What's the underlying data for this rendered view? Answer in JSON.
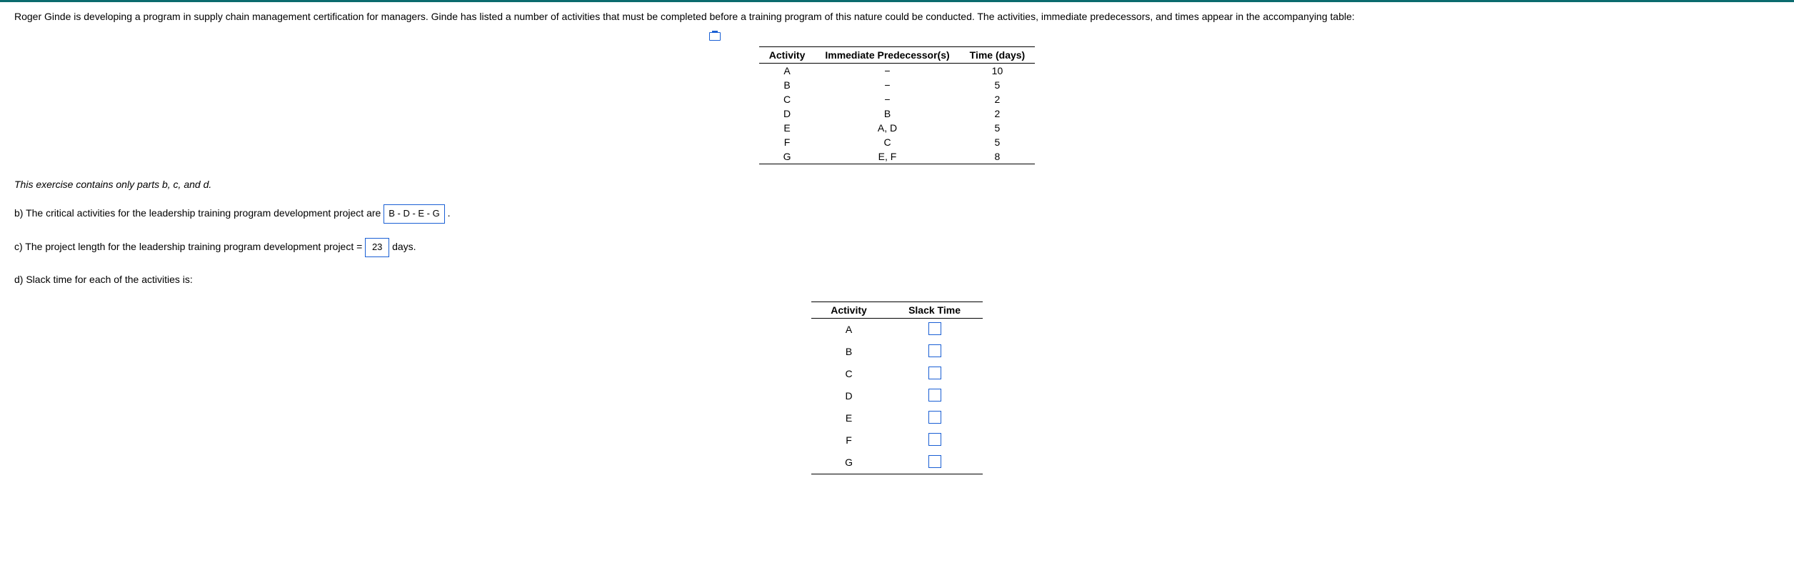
{
  "intro": "Roger Ginde is developing a program in supply chain management certification for managers. Ginde has listed a number of activities that must be completed before a training program of this nature could be conducted. The activities, immediate predecessors, and times appear in the accompanying table:",
  "table1": {
    "headers": {
      "c1": "Activity",
      "c2": "Immediate Predecessor(s)",
      "c3": "Time (days)"
    },
    "rows": [
      {
        "activity": "A",
        "pred": "−",
        "time": "10"
      },
      {
        "activity": "B",
        "pred": "−",
        "time": "5"
      },
      {
        "activity": "C",
        "pred": "−",
        "time": "2"
      },
      {
        "activity": "D",
        "pred": "B",
        "time": "2"
      },
      {
        "activity": "E",
        "pred": "A, D",
        "time": "5"
      },
      {
        "activity": "F",
        "pred": "C",
        "time": "5"
      },
      {
        "activity": "G",
        "pred": "E, F",
        "time": "8"
      }
    ]
  },
  "note": "This exercise contains only parts b, c, and d.",
  "partb": {
    "prefix": "b) The critical activities for the leadership training program development project are",
    "answer": "B - D - E - G",
    "suffix": "."
  },
  "partc": {
    "prefix": "c) The project length for the leadership training program development project = ",
    "answer": "23",
    "suffix": " days."
  },
  "partd": {
    "prefix": "d) Slack time for each of the activities is:"
  },
  "table2": {
    "headers": {
      "c1": "Activity",
      "c2": "Slack Time"
    },
    "rows": [
      {
        "activity": "A"
      },
      {
        "activity": "B"
      },
      {
        "activity": "C"
      },
      {
        "activity": "D"
      },
      {
        "activity": "E"
      },
      {
        "activity": "F"
      },
      {
        "activity": "G"
      }
    ]
  }
}
